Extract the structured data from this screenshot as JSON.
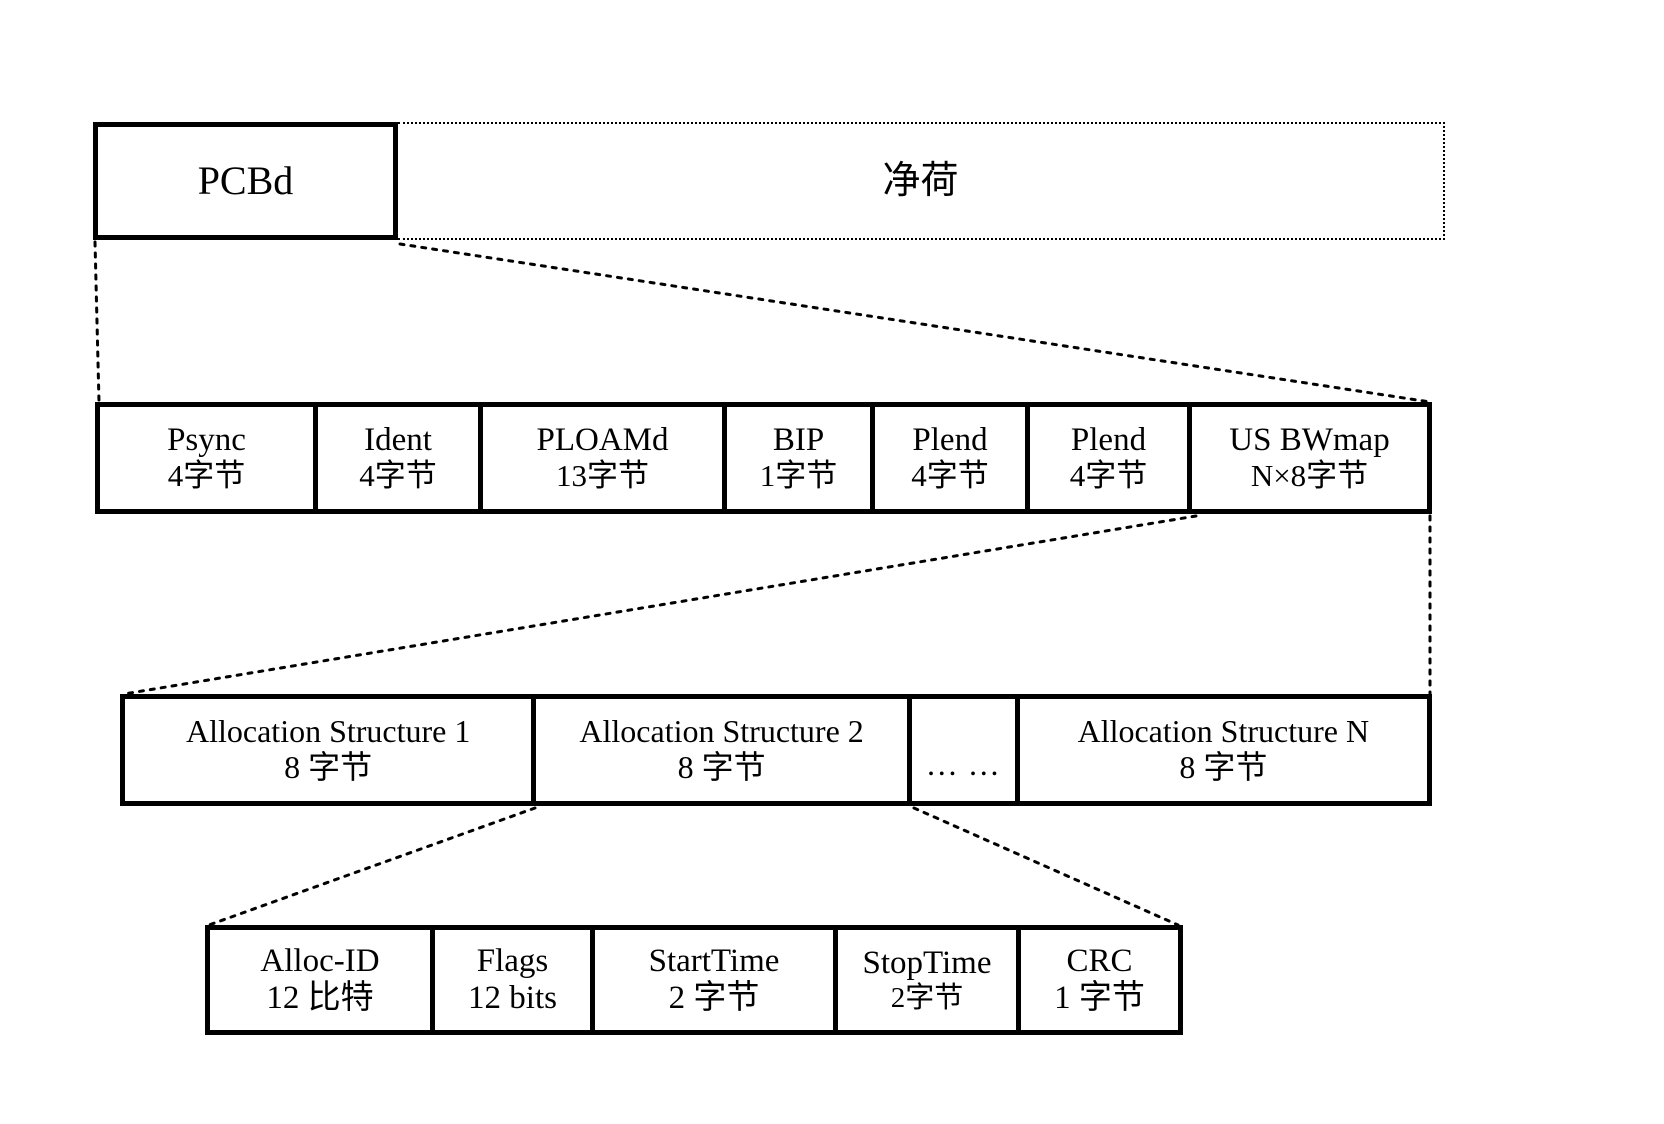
{
  "diagram": {
    "title": "GPON downstream frame structure breakdown",
    "line_style": "dotted",
    "line_color": "#000000"
  },
  "row1": {
    "pcbd": {
      "label": "PCBd"
    },
    "payload": {
      "label": "净荷"
    }
  },
  "row2": {
    "cells": [
      {
        "name": "Psync",
        "size": "4字节"
      },
      {
        "name": "Ident",
        "size": "4字节"
      },
      {
        "name": "PLOAMd",
        "size": "13字节"
      },
      {
        "name": "BIP",
        "size": "1字节"
      },
      {
        "name": "Plend",
        "size": "4字节"
      },
      {
        "name": "Plend",
        "size": "4字节"
      },
      {
        "name": "US BWmap",
        "size": "N×8字节"
      }
    ]
  },
  "row3": {
    "cells": [
      {
        "name": "Allocation Structure 1",
        "size": "8 字节"
      },
      {
        "name": "Allocation Structure 2",
        "size": "8 字节"
      },
      {
        "name": "…  …",
        "size": ""
      },
      {
        "name": "Allocation Structure N",
        "size": "8 字节"
      }
    ]
  },
  "row4": {
    "cells": [
      {
        "name": "Alloc-ID",
        "size": "12 比特"
      },
      {
        "name": "Flags",
        "size": "12 bits"
      },
      {
        "name": "StartTime",
        "size": "2 字节"
      },
      {
        "name": "StopTime",
        "size": "2字节"
      },
      {
        "name": "CRC",
        "size": "1 字节"
      }
    ]
  }
}
